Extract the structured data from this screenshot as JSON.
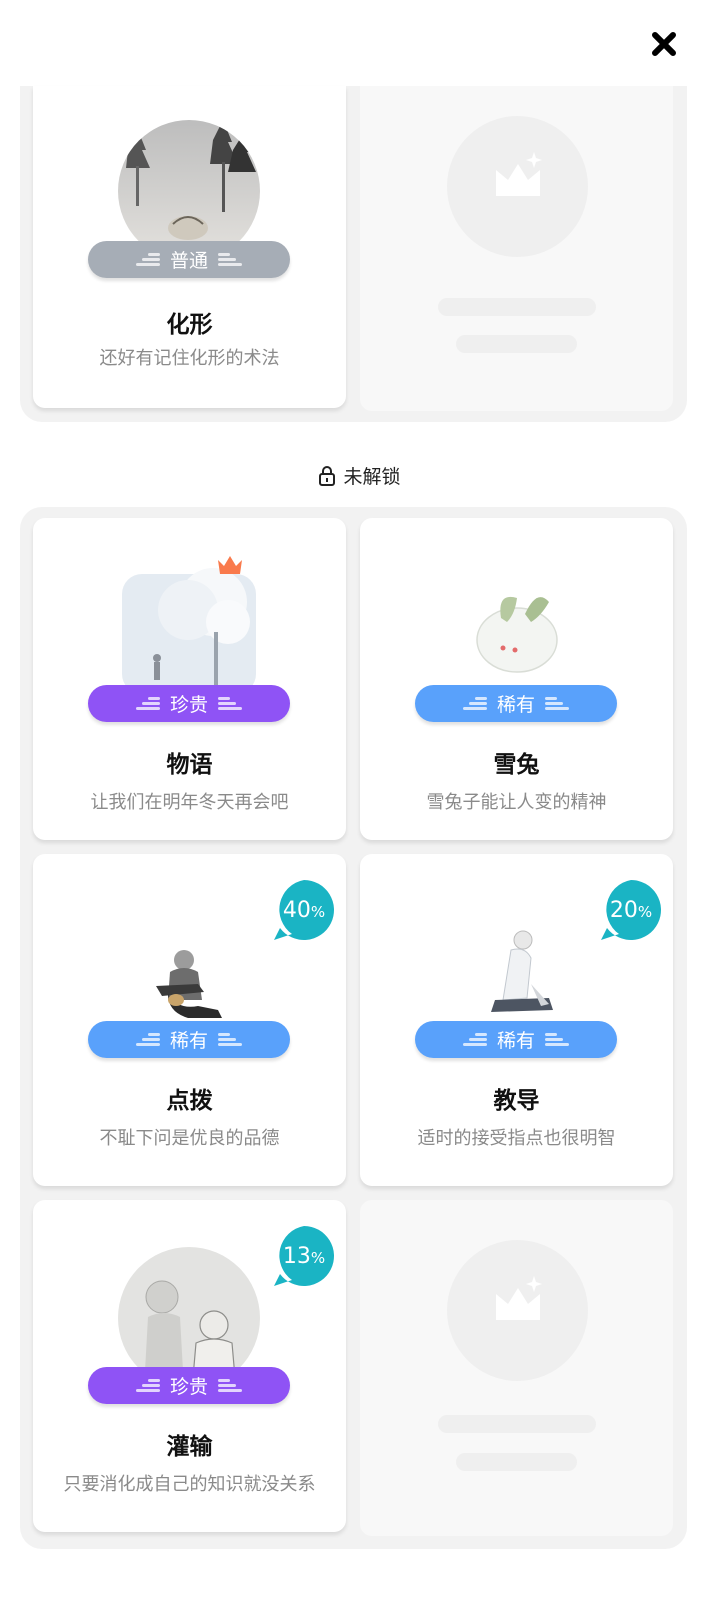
{
  "close_icon": "close-icon",
  "unlocked_section": {
    "cards": [
      {
        "title": "化形",
        "desc": "还好有记住化形的术法",
        "rarity": "普通",
        "rarity_type": "normal"
      }
    ]
  },
  "locked_section": {
    "label": "未解锁",
    "icon": "lock-icon",
    "cards": [
      {
        "title": "物语",
        "desc": "让我们在明年冬天再会吧",
        "rarity": "珍贵",
        "rarity_type": "precious",
        "badge": "crown-icon"
      },
      {
        "title": "雪兔",
        "desc": "雪兔子能让人变的精神",
        "rarity": "稀有",
        "rarity_type": "rare"
      },
      {
        "title": "点拨",
        "desc": "不耻下问是优良的品德",
        "rarity": "稀有",
        "rarity_type": "rare",
        "progress": "40",
        "progress_unit": "%"
      },
      {
        "title": "教导",
        "desc": "适时的接受指点也很明智",
        "rarity": "稀有",
        "rarity_type": "rare",
        "progress": "20",
        "progress_unit": "%"
      },
      {
        "title": "灌输",
        "desc": "只要消化成自己的知识就没关系",
        "rarity": "珍贵",
        "rarity_type": "precious",
        "progress": "13",
        "progress_unit": "%"
      }
    ]
  },
  "colors": {
    "normal": "#a6adb6",
    "precious": "#8f53f5",
    "rare": "#59a1fb",
    "progress": "#1ab4c4",
    "crown": "#f97a4c"
  }
}
